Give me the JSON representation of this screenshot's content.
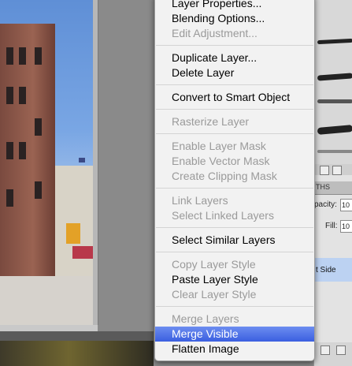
{
  "context_menu": {
    "items": [
      {
        "label": "Layer Properties...",
        "enabled": true
      },
      {
        "label": "Blending Options...",
        "enabled": true
      },
      {
        "label": "Edit Adjustment...",
        "enabled": false
      },
      {
        "label": "Duplicate Layer...",
        "enabled": true
      },
      {
        "label": "Delete Layer",
        "enabled": true
      },
      {
        "label": "Convert to Smart Object",
        "enabled": true
      },
      {
        "label": "Rasterize Layer",
        "enabled": false
      },
      {
        "label": "Enable Layer Mask",
        "enabled": false
      },
      {
        "label": "Enable Vector Mask",
        "enabled": false
      },
      {
        "label": "Create Clipping Mask",
        "enabled": false
      },
      {
        "label": "Link Layers",
        "enabled": false
      },
      {
        "label": "Select Linked Layers",
        "enabled": false
      },
      {
        "label": "Select Similar Layers",
        "enabled": true
      },
      {
        "label": "Copy Layer Style",
        "enabled": false
      },
      {
        "label": "Paste Layer Style",
        "enabled": true
      },
      {
        "label": "Clear Layer Style",
        "enabled": false
      },
      {
        "label": "Merge Layers",
        "enabled": false
      },
      {
        "label": "Merge Visible",
        "enabled": true,
        "highlighted": true
      },
      {
        "label": "Flatten Image",
        "enabled": true
      }
    ]
  },
  "layers_panel": {
    "tab_label": "THS",
    "opacity_label": "pacity:",
    "opacity_value": "10",
    "fill_label": "Fill:",
    "fill_value": "10",
    "selected_layer_name": "t Side"
  },
  "colors": {
    "menu_highlight": "#3a5fe0",
    "disabled_text": "#9a9a9a"
  }
}
